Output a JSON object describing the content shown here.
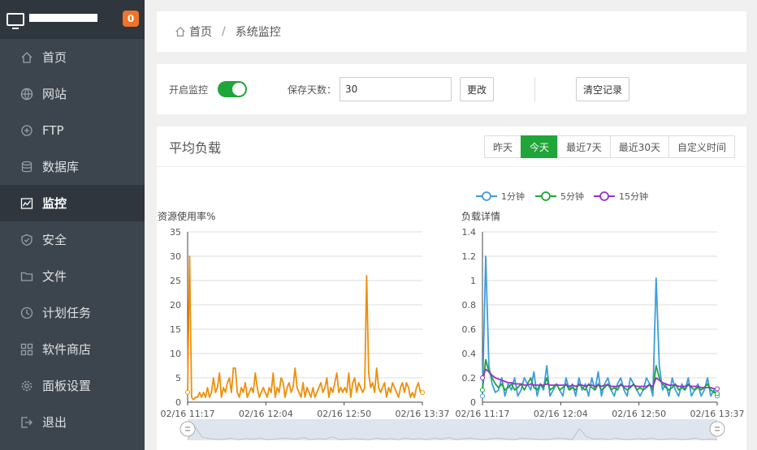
{
  "sidebar": {
    "badge": "0",
    "items": [
      {
        "label": "首页",
        "icon": "home-icon"
      },
      {
        "label": "网站",
        "icon": "globe-icon"
      },
      {
        "label": "FTP",
        "icon": "ftp-icon"
      },
      {
        "label": "数据库",
        "icon": "database-icon"
      },
      {
        "label": "监控",
        "icon": "monitor-chart-icon"
      },
      {
        "label": "安全",
        "icon": "shield-icon"
      },
      {
        "label": "文件",
        "icon": "folder-icon"
      },
      {
        "label": "计划任务",
        "icon": "clock-icon"
      },
      {
        "label": "软件商店",
        "icon": "grid-icon"
      },
      {
        "label": "面板设置",
        "icon": "gear-icon"
      },
      {
        "label": "退出",
        "icon": "logout-icon"
      }
    ],
    "active_index": 4
  },
  "breadcrumb": {
    "home": "首页",
    "separator": "/",
    "current": "系统监控"
  },
  "controls": {
    "enable_label": "开启监控",
    "enabled": true,
    "days_label": "保存天数：",
    "days_value": "30",
    "change_button": "更改",
    "clear_button": "清空记录"
  },
  "panel": {
    "title": "平均负载",
    "ranges": [
      "昨天",
      "今天",
      "最近7天",
      "最近30天",
      "自定义时间"
    ],
    "active_range": 1
  },
  "colors": {
    "accent": "#20a53a",
    "badge": "#f0732a",
    "cpu_line": "#ee8f0b",
    "load1": "#3c9de0",
    "load5": "#20a53a",
    "load15": "#9b30d0"
  },
  "chart_data": [
    {
      "type": "line",
      "title": "资源使用率%",
      "ylim": [
        0,
        35
      ],
      "yticks": [
        0,
        5,
        10,
        15,
        20,
        25,
        30,
        35
      ],
      "xticks": [
        "02/16 11:17",
        "02/16 12:04",
        "02/16 12:50",
        "02/16 13:37"
      ],
      "grid": true,
      "series": [
        {
          "values": [
            2,
            30,
            1,
            0.5,
            1,
            1,
            2,
            1,
            2,
            1,
            3,
            1,
            2,
            5,
            2,
            3,
            6,
            1,
            3,
            2,
            4,
            5,
            2,
            7,
            7,
            2,
            1,
            3,
            2,
            4,
            1,
            2,
            3,
            2,
            6,
            3,
            1,
            2,
            3,
            2,
            1,
            3,
            2,
            6,
            1,
            3,
            2,
            5,
            4,
            1,
            3,
            4,
            2,
            3,
            7,
            3,
            2,
            1,
            4,
            1,
            3,
            2,
            1,
            3,
            1,
            2,
            3,
            4,
            2,
            3,
            5,
            1,
            3,
            2,
            4,
            6,
            2,
            3,
            2,
            3,
            2,
            6,
            1,
            4,
            5,
            2,
            4,
            3,
            2,
            3,
            26,
            6,
            3,
            4,
            2,
            7,
            3,
            2,
            3,
            4,
            1,
            3,
            2,
            4,
            3,
            2,
            1,
            3,
            4,
            2,
            4,
            3,
            1,
            2,
            1,
            3,
            4,
            2,
            2
          ]
        }
      ]
    },
    {
      "type": "line",
      "title": "负载详情",
      "ylim": [
        0,
        1.4
      ],
      "yticks": [
        0,
        0.2,
        0.4,
        0.6,
        0.8,
        1,
        1.2,
        1.4
      ],
      "xticks": [
        "02/16 11:17",
        "02/16 12:04",
        "02/16 12:50",
        "02/16 13:37"
      ],
      "legend": "top",
      "grid": true,
      "series": [
        {
          "name": "1分钟",
          "values": [
            0.05,
            1.2,
            0.3,
            0.15,
            0.08,
            0.1,
            0.2,
            0.05,
            0.15,
            0.1,
            0.2,
            0.05,
            0.1,
            0.2,
            0.15,
            0.1,
            0.25,
            0.05,
            0.15,
            0.1,
            0.3,
            0.05,
            0.1,
            0.15,
            0.1,
            0.05,
            0.2,
            0.1,
            0.15,
            0.05,
            0.2,
            0.1,
            0.15,
            0.05,
            0.2,
            0.1,
            0.25,
            0.05,
            0.15,
            0.2,
            0.1,
            0.05,
            0.15,
            0.2,
            0.1,
            0.05,
            0.2,
            0.15,
            0.1,
            0.05,
            0.1,
            0.2,
            0.15,
            0.05,
            1.02,
            0.3,
            0.1,
            0.15,
            0.05,
            0.2,
            0.1,
            0.05,
            0.15,
            0.1,
            0.2,
            0.05,
            0.1,
            0.15,
            0.05,
            0.1,
            0.2,
            0.05,
            0.1,
            0.05
          ]
        },
        {
          "name": "5分钟",
          "values": [
            0.1,
            0.35,
            0.25,
            0.2,
            0.15,
            0.12,
            0.15,
            0.1,
            0.12,
            0.15,
            0.1,
            0.12,
            0.15,
            0.1,
            0.15,
            0.2,
            0.12,
            0.1,
            0.15,
            0.12,
            0.2,
            0.1,
            0.12,
            0.15,
            0.1,
            0.12,
            0.15,
            0.1,
            0.12,
            0.1,
            0.15,
            0.12,
            0.1,
            0.15,
            0.12,
            0.1,
            0.15,
            0.1,
            0.12,
            0.15,
            0.1,
            0.12,
            0.1,
            0.15,
            0.12,
            0.1,
            0.12,
            0.15,
            0.1,
            0.12,
            0.1,
            0.12,
            0.15,
            0.1,
            0.3,
            0.2,
            0.15,
            0.12,
            0.1,
            0.12,
            0.15,
            0.1,
            0.12,
            0.1,
            0.15,
            0.12,
            0.1,
            0.12,
            0.1,
            0.12,
            0.15,
            0.1,
            0.08,
            0.07
          ]
        },
        {
          "name": "15分钟",
          "values": [
            0.2,
            0.27,
            0.25,
            0.22,
            0.2,
            0.19,
            0.18,
            0.17,
            0.16,
            0.16,
            0.15,
            0.15,
            0.15,
            0.14,
            0.14,
            0.15,
            0.14,
            0.14,
            0.14,
            0.14,
            0.15,
            0.14,
            0.14,
            0.14,
            0.14,
            0.14,
            0.14,
            0.13,
            0.14,
            0.13,
            0.14,
            0.14,
            0.13,
            0.14,
            0.14,
            0.13,
            0.14,
            0.13,
            0.14,
            0.14,
            0.13,
            0.13,
            0.13,
            0.14,
            0.13,
            0.13,
            0.13,
            0.14,
            0.13,
            0.13,
            0.13,
            0.13,
            0.14,
            0.13,
            0.2,
            0.18,
            0.16,
            0.15,
            0.14,
            0.14,
            0.14,
            0.13,
            0.13,
            0.13,
            0.14,
            0.13,
            0.13,
            0.13,
            0.12,
            0.12,
            0.12,
            0.12,
            0.11,
            0.11
          ]
        }
      ]
    }
  ]
}
